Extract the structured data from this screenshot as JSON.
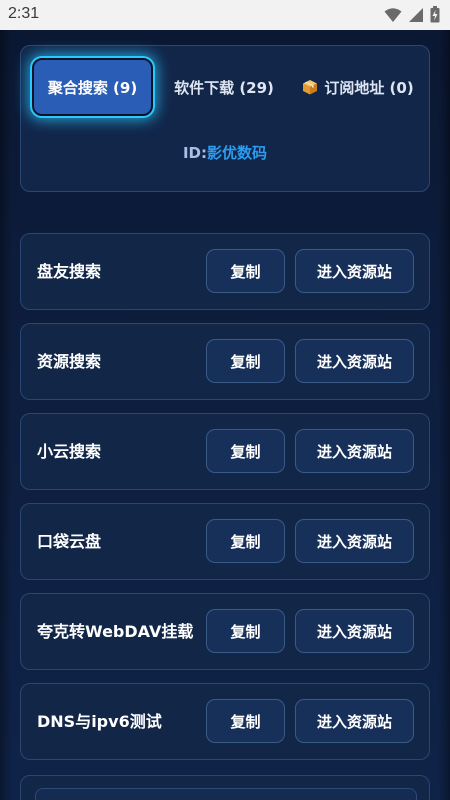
{
  "status": {
    "time": "2:31",
    "icons": [
      "wifi-icon",
      "signal-icon",
      "battery-icon"
    ]
  },
  "tabs": [
    {
      "label": "聚合搜索 (9)",
      "active": true
    },
    {
      "label": "软件下载 (29)",
      "active": false
    },
    {
      "label": "订阅地址 (0)",
      "active": false,
      "icon": "package-icon"
    }
  ],
  "id_line": {
    "label": "ID:",
    "value": "影优数码"
  },
  "sites": [
    {
      "name": "盘友搜索",
      "copy_label": "复制",
      "enter_label": "进入资源站"
    },
    {
      "name": "资源搜索",
      "copy_label": "复制",
      "enter_label": "进入资源站"
    },
    {
      "name": "小云搜索",
      "copy_label": "复制",
      "enter_label": "进入资源站"
    },
    {
      "name": "口袋云盘",
      "copy_label": "复制",
      "enter_label": "进入资源站"
    },
    {
      "name": "夸克转WebDAV挂载",
      "copy_label": "复制",
      "enter_label": "进入资源站"
    },
    {
      "name": "DNS与ipv6测试",
      "copy_label": "复制",
      "enter_label": "进入资源站"
    }
  ],
  "colors": {
    "background": "#0c1a38",
    "card": "#122648",
    "active_tab": "#2a5db6",
    "glow": "#29c9ff",
    "id_value": "#2c9cf0"
  }
}
